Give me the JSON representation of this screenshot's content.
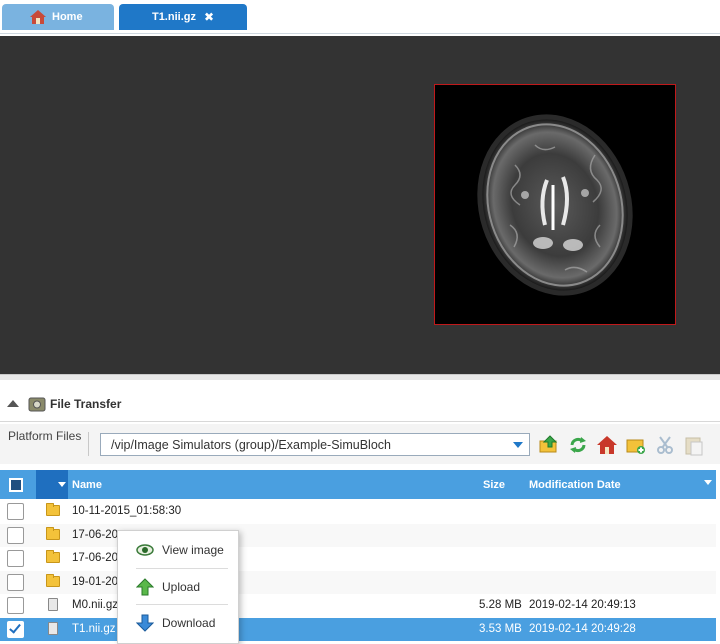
{
  "tabs": [
    {
      "label": "Home"
    },
    {
      "label": "T1.nii.gz",
      "close": "✖"
    }
  ],
  "file_transfer": {
    "title": "File Transfer"
  },
  "toolbar": {
    "label": "Platform Files",
    "path": "/vip/Image Simulators (group)/Example-SimuBloch",
    "icons": [
      "folder-up-icon",
      "refresh-icon",
      "home-icon",
      "new-folder-icon",
      "cut-icon",
      "paste-icon"
    ]
  },
  "grid": {
    "columns": {
      "name": "Name",
      "size": "Size",
      "date": "Modification Date"
    },
    "rows": [
      {
        "type": "folder",
        "name": "10-11-2015_01:58:30",
        "size": "",
        "date": "",
        "checked": false
      },
      {
        "type": "folder",
        "name": "17-06-20",
        "size": "",
        "date": "",
        "checked": false
      },
      {
        "type": "folder",
        "name": "17-06-20",
        "size": "",
        "date": "",
        "checked": false
      },
      {
        "type": "folder",
        "name": "19-01-20",
        "size": "",
        "date": "",
        "checked": false
      },
      {
        "type": "file",
        "name": "M0.nii.gz",
        "size": "5.28 MB",
        "date": "2019-02-14 20:49:13",
        "checked": false
      },
      {
        "type": "file",
        "name": "T1.nii.gz",
        "size": "3.53 MB",
        "date": "2019-02-14 20:49:28",
        "checked": true
      }
    ]
  },
  "context_menu": {
    "items": [
      {
        "label": "View image",
        "icon": "eye-icon"
      },
      {
        "label": "Upload",
        "icon": "upload-arrow-icon"
      },
      {
        "label": "Download",
        "icon": "download-arrow-icon"
      }
    ]
  },
  "colors": {
    "accent": "#1f78c8",
    "header_blue": "#4a9fe0",
    "viewer_bg": "#333333",
    "image_border": "#c0191b"
  }
}
